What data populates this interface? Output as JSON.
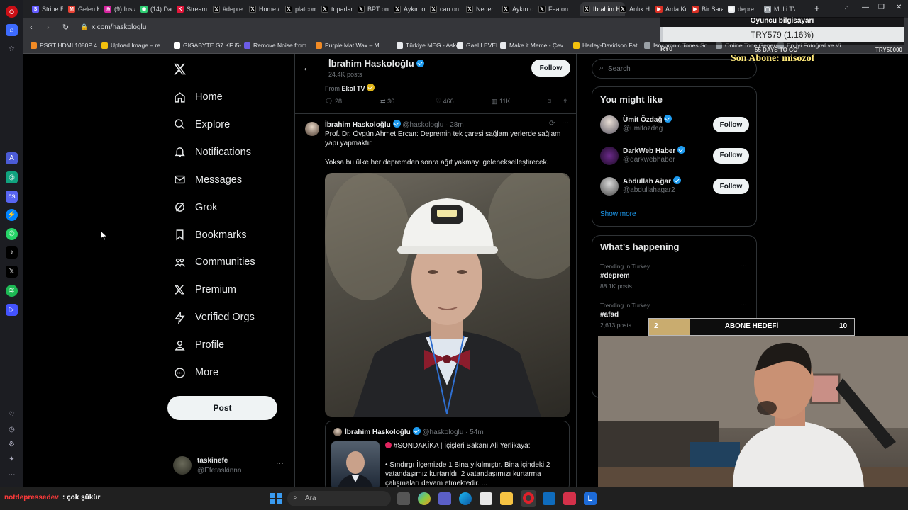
{
  "browser": {
    "tabs": [
      {
        "label": "Stripe E",
        "color": "#635bff",
        "letter": "S"
      },
      {
        "label": "Gelen K",
        "color": "#ea4335",
        "letter": "M"
      },
      {
        "label": "(9) Insta",
        "color": "#d6249f",
        "letter": "◎"
      },
      {
        "label": "(14) Da",
        "color": "#2ecc71",
        "letter": "◉"
      },
      {
        "label": "Stream",
        "color": "#e4163a",
        "letter": "K"
      },
      {
        "label": "#depre",
        "color": "#000000",
        "letter": "𝕏"
      },
      {
        "label": "Home /",
        "color": "#000000",
        "letter": "𝕏"
      },
      {
        "label": "platcom",
        "color": "#000000",
        "letter": "𝕏"
      },
      {
        "label": "toparlan",
        "color": "#000000",
        "letter": "𝕏"
      },
      {
        "label": "BPT on",
        "color": "#000000",
        "letter": "𝕏"
      },
      {
        "label": "Aykırı or",
        "color": "#000000",
        "letter": "𝕏"
      },
      {
        "label": "can on",
        "color": "#000000",
        "letter": "𝕏"
      },
      {
        "label": "Neden T",
        "color": "#000000",
        "letter": "𝕏"
      },
      {
        "label": "Aykırı or",
        "color": "#000000",
        "letter": "𝕏"
      },
      {
        "label": "Fea on",
        "color": "#000000",
        "letter": "𝕏"
      },
      {
        "label": "İbrahim Hasko",
        "color": "#000000",
        "letter": "𝕏"
      },
      {
        "label": "Anlık Ha",
        "color": "#000000",
        "letter": "𝕏"
      },
      {
        "label": "Arda Ku",
        "color": "#d93025",
        "letter": "▶"
      },
      {
        "label": "Bir Sara",
        "color": "#d93025",
        "letter": "▶"
      },
      {
        "label": "depre",
        "color": "#e8eaed",
        "letter": "▤"
      },
      {
        "label": "Multi TV",
        "color": "#9aa0a6",
        "letter": "▢"
      }
    ],
    "new_tab_symbol": "+",
    "url": "x.com/haskologlu",
    "bookmarks": [
      {
        "label": "PSGT HDMI 1080P 4...",
        "color": "#f28b25"
      },
      {
        "label": "Upload Image – re...",
        "color": "#f4c20d"
      },
      {
        "label": "GIGABYTE G7 KF i5-...",
        "color": "#ffffff"
      },
      {
        "label": "Remove Noise from...",
        "color": "#6c5ce7"
      },
      {
        "label": "Purple Mat Wax – M...",
        "color": "#f28b25"
      },
      {
        "label": "Türkiye MEG - Asker...",
        "color": "#e8eaed"
      },
      {
        "label": "Gael LEVEL",
        "color": "#e8eaed"
      },
      {
        "label": "Make it Meme - Çev...",
        "color": "#e8eaed"
      },
      {
        "label": "Harley-Davidson Fat...",
        "color": "#f4c20d"
      },
      {
        "label": "Isochronic Tones So...",
        "color": "#9aa0a6"
      },
      {
        "label": "Online Tone Genera...",
        "color": "#9aa0a6"
      },
      {
        "label": "En İyi Fotoğraf ve Vi...",
        "color": "#9aa0a6"
      }
    ]
  },
  "nav": {
    "items": [
      {
        "label": "Home",
        "icon": "home-icon"
      },
      {
        "label": "Explore",
        "icon": "search-icon"
      },
      {
        "label": "Notifications",
        "icon": "bell-icon"
      },
      {
        "label": "Messages",
        "icon": "envelope-icon"
      },
      {
        "label": "Grok",
        "icon": "grok-icon"
      },
      {
        "label": "Bookmarks",
        "icon": "bookmark-icon"
      },
      {
        "label": "Communities",
        "icon": "people-icon"
      },
      {
        "label": "Premium",
        "icon": "x-logo-icon"
      },
      {
        "label": "Verified Orgs",
        "icon": "lightning-icon"
      },
      {
        "label": "Profile",
        "icon": "person-icon"
      },
      {
        "label": "More",
        "icon": "more-circle-icon"
      }
    ],
    "post_label": "Post",
    "account": {
      "name": "taskinefe",
      "handle": "@Efetaskinnn",
      "more": "···"
    }
  },
  "profile_header": {
    "name": "İbrahim Haskoloğlu",
    "posts": "24.4K posts",
    "follow_label": "Follow"
  },
  "prev_post": {
    "from_prefix": "From",
    "from_source": "Ekol TV",
    "replies": "28",
    "reposts": "36",
    "likes": "466",
    "views": "11K"
  },
  "post": {
    "name": "İbrahim Haskoloğlu",
    "handle": "@haskologlu",
    "time": "28m",
    "dot": "·",
    "text1": "Prof. Dr. Övgün Ahmet Ercan:  Depremin tek çaresi sağlam yerlerde sağlam yapı yapmaktır.",
    "text2": "Yoksa bu ülke her depremden sonra ağıt yakmayı gelenekselleştirecek.",
    "more": "···"
  },
  "quoted": {
    "name": "İbrahim Haskoloğlu",
    "handle": "@haskologlu",
    "time": "54m",
    "line1": "#SONDAKİKA | İçişleri Bakanı Ali Yerlikaya:",
    "line2": "• Sındırgı İlçemizde 1 Bina yıkılmıştır. Bina içindeki 2 vatandaşımız kurtarıldı,  2 vatandaşımızı kurtarma çalışmaları devam etmektedir. ..."
  },
  "search": {
    "placeholder": "Search"
  },
  "suggestions": {
    "title": "You might like",
    "users": [
      {
        "name": "Ümit Özdağ",
        "handle": "@umitozdag",
        "follow": "Follow"
      },
      {
        "name": "DarkWeb Haber",
        "handle": "@darkwebhaber",
        "follow": "Follow"
      },
      {
        "name": "Abdullah Ağar",
        "handle": "@abdullahagar2",
        "follow": "Follow"
      }
    ],
    "show_more": "Show more"
  },
  "trends": {
    "title": "What’s happening",
    "items": [
      {
        "context": "Trending in Turkey",
        "tag": "#deprem",
        "posts": "88.1K posts"
      },
      {
        "context": "Trending in Turkey",
        "tag": "#afad",
        "posts": "2,613 posts"
      }
    ],
    "more": "···"
  },
  "overlay": {
    "goal_title": "Oyuncu bilgisayarı",
    "goal_amount": "TRY579 (1.16%)",
    "goal_left": "RY0",
    "goal_days": "55 DAYS TO GO",
    "goal_target": "TRY50000",
    "last_sub": "Son Abone: misozof",
    "sub_goal_current": "2",
    "sub_goal_label": "ABONE HEDEFİ",
    "sub_goal_target": "10",
    "sub_goal_progress": 0.2,
    "chat_user": "notdepressedev",
    "chat_message": ": çok şükür"
  },
  "taskbar": {
    "search_placeholder": "Ara"
  }
}
